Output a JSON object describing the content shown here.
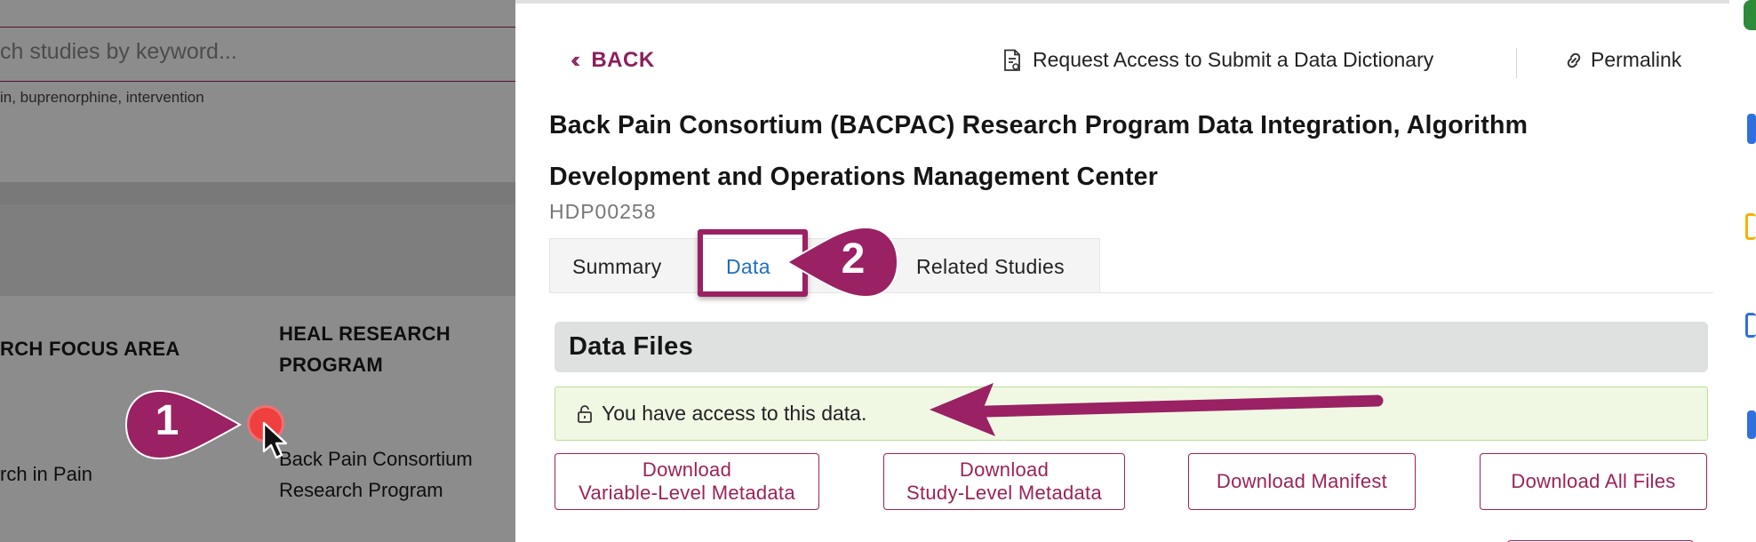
{
  "background": {
    "search_placeholder": "ch studies by keyword...",
    "search_hint": "in, buprenorphine, intervention",
    "columns": {
      "focus_area": "RCH FOCUS AREA",
      "research_program": "HEAL RESEARCH PROGRAM"
    },
    "row": {
      "focus_area": "rch in Pain",
      "research_program": "Back Pain Consortium Research Program"
    }
  },
  "drawer": {
    "back_label": "BACK",
    "request_access_label": "Request Access to Submit a Data Dictionary",
    "permalink_label": "Permalink",
    "study_title": "Back Pain Consortium (BACPAC) Research Program Data Integration, Algorithm Development and Operations Management Center",
    "study_id": "HDP00258",
    "tabs": [
      {
        "label": "Summary"
      },
      {
        "label": "Data",
        "active": true
      },
      {
        "label": "Related Studies"
      }
    ],
    "data_files_title": "Data Files",
    "access_message": "You have access to this data.",
    "buttons": {
      "variable_metadata": {
        "line1": "Download",
        "line2": "Variable-Level Metadata"
      },
      "study_metadata": {
        "line1": "Download",
        "line2": "Study-Level Metadata"
      },
      "manifest": "Download Manifest",
      "all_files": "Download All Files"
    }
  },
  "annotations": {
    "callout_1": "1",
    "callout_2": "2"
  },
  "colors": {
    "brand": "#9b2257",
    "annotation": "#9a2163",
    "active_tab": "#1f6fc1",
    "access_bg": "#f0f8e4",
    "click_marker": "#ef3f3f"
  },
  "icons": [
    "chevrons-left-icon",
    "document-icon",
    "link-icon",
    "unlock-icon",
    "mouse-cursor-icon"
  ]
}
